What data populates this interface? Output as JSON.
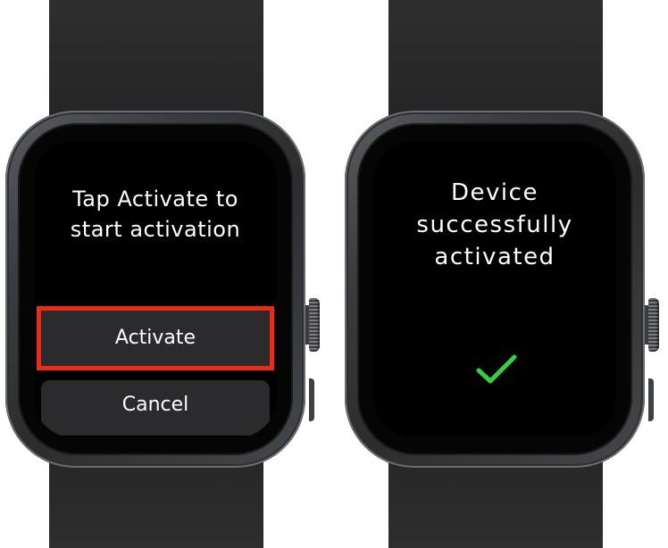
{
  "left_watch": {
    "prompt": "Tap Activate to\nstart activation",
    "activate_label": "Activate",
    "cancel_label": "Cancel",
    "highlight_color": "#ee2a14"
  },
  "right_watch": {
    "message": "Device\nsuccessfully\nactivated",
    "status_icon": "checkmark-icon",
    "check_color": "#33d13f"
  }
}
